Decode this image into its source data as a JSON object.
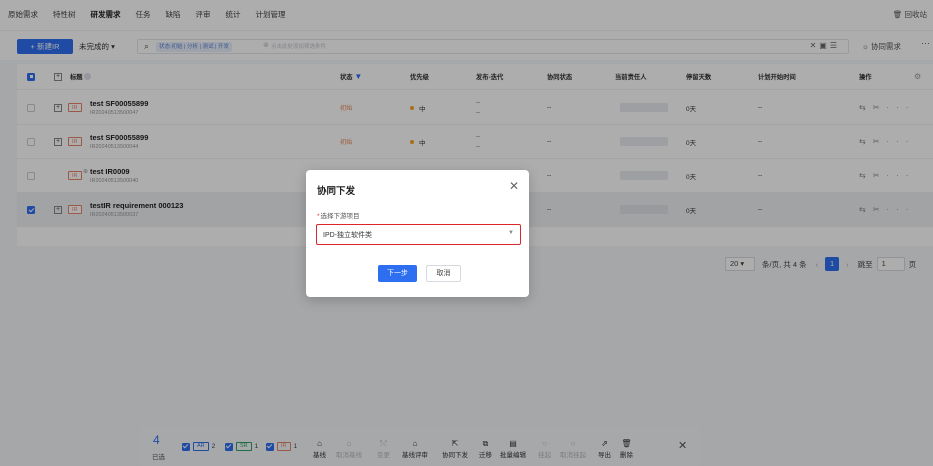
{
  "nav": {
    "tabs": [
      "原始需求",
      "特性树",
      "研发需求",
      "任务",
      "缺陷",
      "评审",
      "统计",
      "计划管理"
    ],
    "active_index": 2,
    "recycle_label": "回收站"
  },
  "toolbar": {
    "new_label": "+ 新建IR",
    "status_filter": "未完成的 ▾",
    "search_filter_chip": "状态:初始 | 分析 | 测试 | 开发",
    "search_placeholder": "点击此处添加筛选条件",
    "collab_label": "协同需求",
    "more": "···"
  },
  "table": {
    "header": {
      "title": "标题",
      "status": "状态",
      "priority": "优先级",
      "release": "发布-迭代",
      "collab_status": "协同状态",
      "owner": "当前责任人",
      "stay_days": "停留天数",
      "plan_start": "计划开始时间",
      "ops": "操作"
    },
    "rows": [
      {
        "title": "test SF00055899",
        "id": "IR20240513500047",
        "tag": "IR",
        "status": "初始",
        "priority": "中",
        "release": "--",
        "release2": "--",
        "collab": "--",
        "days": "0天",
        "plan": "--",
        "checked": false,
        "expandable": true
      },
      {
        "title": "test SF00055899",
        "id": "IR20240513500044",
        "tag": "IR",
        "status": "初始",
        "priority": "中",
        "release": "--",
        "release2": "--",
        "collab": "--",
        "days": "0天",
        "plan": "--",
        "checked": false,
        "expandable": true
      },
      {
        "title": "test IR0009",
        "id": "IR20240513500040",
        "tag": "IR",
        "status": "",
        "priority": "",
        "release": "",
        "release2": "",
        "collab": "--",
        "days": "0天",
        "plan": "--",
        "checked": false,
        "expandable": false
      },
      {
        "title": "testIR requirement 000123",
        "id": "IR20240513500037",
        "tag": "IR",
        "status": "",
        "priority": "",
        "release": "",
        "release2": "",
        "collab": "--",
        "days": "0天",
        "plan": "--",
        "checked": true,
        "expandable": true
      }
    ]
  },
  "pagination": {
    "page_size": "20",
    "summary": "条/页, 共 4 条",
    "current_page": "1",
    "goto_label": "跳至",
    "goto_value": "1",
    "page_suffix": "页"
  },
  "modal": {
    "title": "协同下发",
    "label": "选择下游项目",
    "select_value": "IPD-独立软件类",
    "next_label": "下一步",
    "cancel_label": "取消",
    "close": "✕"
  },
  "bulkbar": {
    "count": "4",
    "selected_label": "已选",
    "chips": [
      {
        "tag": "AR",
        "count": "2",
        "color": "#2e6ff2"
      },
      {
        "tag": "SR",
        "count": "1",
        "color": "#2ea36a"
      },
      {
        "tag": "IR",
        "count": "1",
        "color": "#e8836b"
      }
    ],
    "actions": [
      {
        "label": "基线",
        "enabled": true
      },
      {
        "label": "取消基线",
        "enabled": false
      },
      {
        "label": "变更",
        "enabled": false
      },
      {
        "label": "基线评审",
        "enabled": true
      },
      {
        "label": "协同下发",
        "enabled": true
      },
      {
        "label": "迁移",
        "enabled": true
      },
      {
        "label": "批量编辑",
        "enabled": true
      },
      {
        "label": "挂起",
        "enabled": false
      },
      {
        "label": "取消挂起",
        "enabled": false
      },
      {
        "label": "导出",
        "enabled": true
      },
      {
        "label": "删除",
        "enabled": true
      }
    ]
  },
  "colors": {
    "primary": "#2e6ff2",
    "ir_tag": "#e8836b",
    "status_new": "#e98a5a",
    "priority_mid": "#f5a623",
    "highlight_border": "#d9262c"
  }
}
